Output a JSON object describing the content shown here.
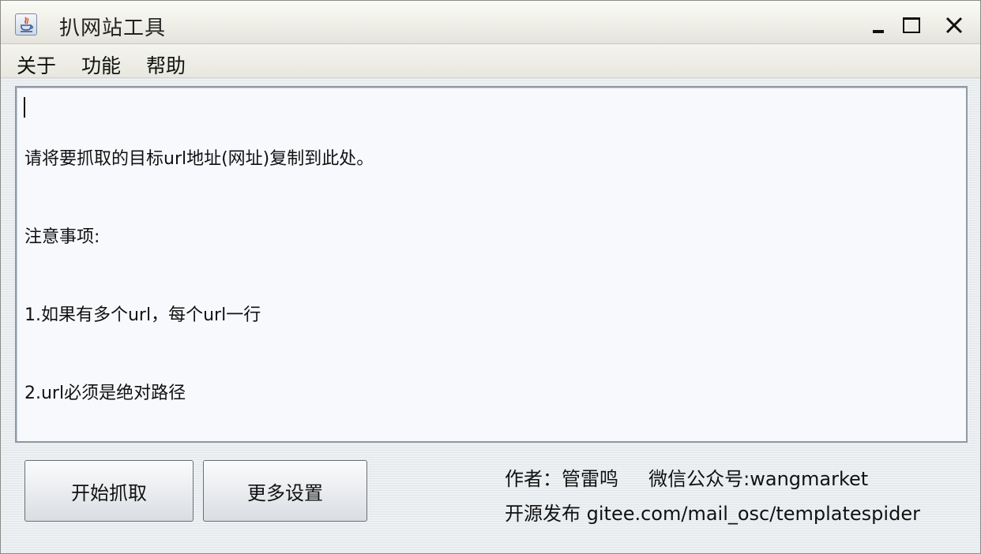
{
  "window": {
    "title": "扒网站工具",
    "icon": "java-cup-icon"
  },
  "menu": {
    "items": [
      "关于",
      "功能",
      "帮助"
    ]
  },
  "textarea": {
    "lines": [
      "请将要抓取的目标url地址(网址)复制到此处。",
      "注意事项:",
      "1.如果有多个url，每个url一行",
      "2.url必须是绝对路径"
    ]
  },
  "buttons": {
    "start": "开始抓取",
    "more_settings": "更多设置"
  },
  "info": {
    "author_line": "作者：管雷鸣     微信公众号:wangmarket",
    "source_line": "开源发布 gitee.com/mail_osc/templatespider"
  },
  "colors": {
    "window_bg": "#eef1f3",
    "textarea_bg": "#f8f9fd",
    "titlebar_bg": "#eeeee6"
  }
}
